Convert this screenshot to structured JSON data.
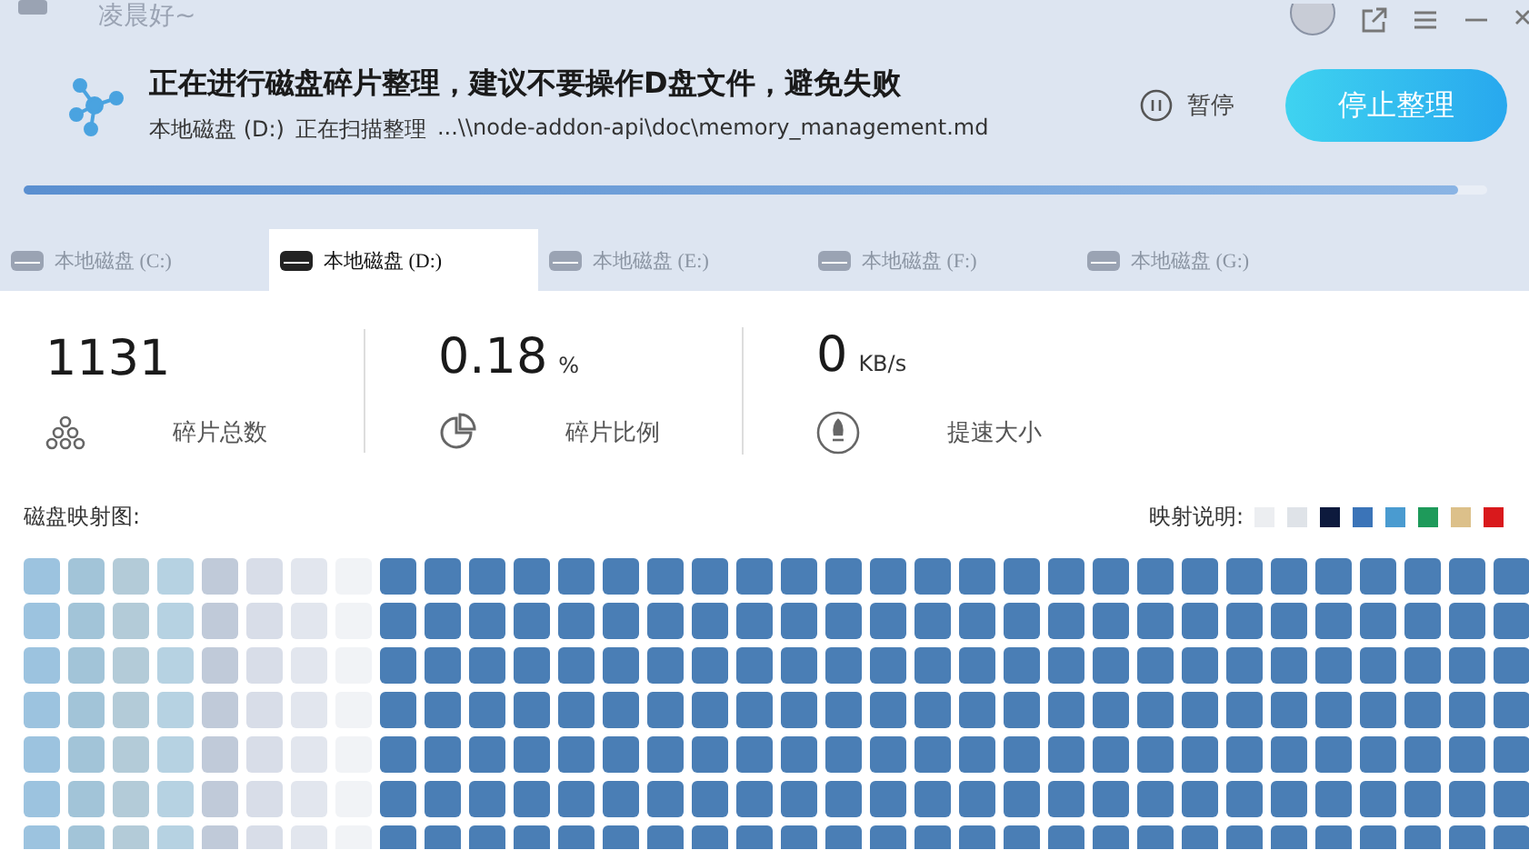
{
  "window": {
    "title": "凌晨好~"
  },
  "banner": {
    "heading": "正在进行磁盘碎片整理，建议不要操作D盘文件，避免失败",
    "drive": "本地磁盘 (D:)",
    "status": "正在扫描整理",
    "path": "...\\\\node-addon-api\\doc\\memory_management.md",
    "pause_label": "暂停",
    "stop_label": "停止整理",
    "progress": {
      "level": 0.98
    }
  },
  "tabs": [
    {
      "label": "本地磁盘 (C:)",
      "selected": false
    },
    {
      "label": "本地磁盘 (D:)",
      "selected": true
    },
    {
      "label": "本地磁盘 (E:)",
      "selected": false
    },
    {
      "label": "本地磁盘 (F:)",
      "selected": false
    },
    {
      "label": "本地磁盘 (G:)",
      "selected": false
    }
  ],
  "stats": [
    {
      "kind": "fragments",
      "value": "1131",
      "label": "碎片总数"
    },
    {
      "kind": "ratio",
      "value": "0.18",
      "unit": "%",
      "label": "碎片比例"
    },
    {
      "kind": "speed",
      "value": "0",
      "unit": "KB/s",
      "label": "提速大小"
    }
  ],
  "map": {
    "title": "磁盘映射图:",
    "legend_title": "映射说明:",
    "legend": [
      {
        "color": "#eceef1"
      },
      {
        "color": "#dfe3e8"
      },
      {
        "color": "#0d1a3d"
      },
      {
        "color": "#3b74b8"
      },
      {
        "color": "#4a9bd0"
      },
      {
        "color": "#1e9a5a"
      },
      {
        "color": "#dcc08a"
      },
      {
        "color": "#d9191c"
      }
    ]
  }
}
